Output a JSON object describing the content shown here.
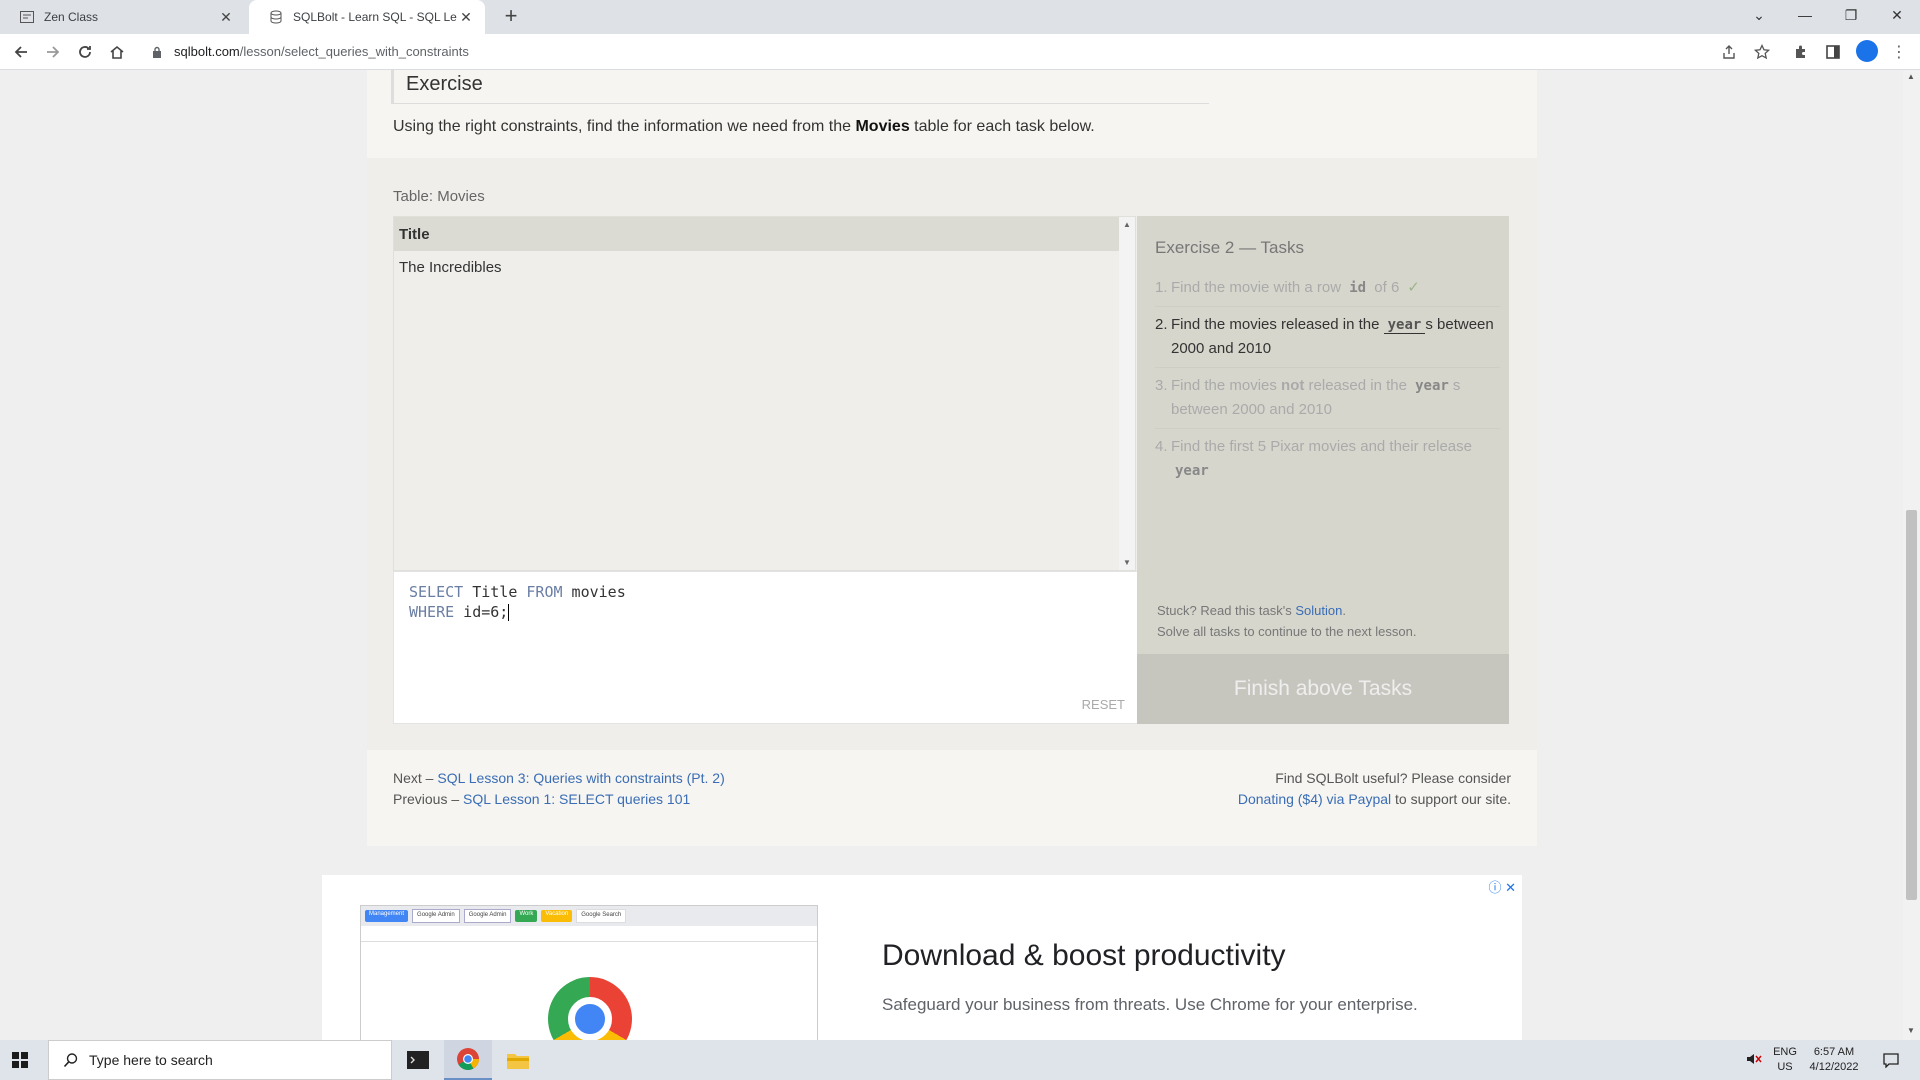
{
  "browser": {
    "tabs": [
      {
        "title": "Zen Class",
        "close": "✕"
      },
      {
        "title": "SQLBolt - Learn SQL - SQL Lesson",
        "close": "✕"
      }
    ],
    "new_tab": "+",
    "url_domain": "sqlbolt.com",
    "url_path": "/lesson/select_queries_with_constraints"
  },
  "page": {
    "exercise_heading": "Exercise",
    "intro_before": "Using the right constraints, find the information we need from the ",
    "intro_bold": "Movies",
    "intro_after": " table for each task below.",
    "table_label": "Table: Movies",
    "results": {
      "columns": [
        "Title"
      ],
      "rows": [
        [
          "The Incredibles"
        ]
      ]
    },
    "editor": {
      "line1": {
        "kw1": "SELECT",
        "t1": " Title ",
        "kw2": "FROM",
        "t2": " movies"
      },
      "line2": {
        "kw1": "WHERE",
        "t1": " id=6;"
      },
      "reset_label": "RESET"
    },
    "tasks": {
      "title": "Exercise 2 — Tasks",
      "items": [
        {
          "num": "1.",
          "pre": "Find the movie with a row ",
          "code": "id",
          "post": " of 6",
          "check": "✓"
        },
        {
          "num": "2.",
          "pre": "Find the movies released in the ",
          "code": "year",
          "post": "s between 2000 and 2010"
        },
        {
          "num": "3.",
          "pre": "Find the movies ",
          "bold": "not",
          "mid": " released in the ",
          "code": "year",
          "post": "s between 2000 and 2010"
        },
        {
          "num": "4.",
          "pre": "Find the first 5 Pixar movies and their release ",
          "code": "year"
        }
      ],
      "stuck_text": "Stuck? Read this task's ",
      "solution_link": "Solution",
      "stuck_end": ".",
      "continue_text": "Solve all tasks to continue to the next lesson.",
      "finish_button": "Finish above Tasks"
    },
    "footer": {
      "next_prefix": "Next – ",
      "next_link": "SQL Lesson 3: Queries with constraints (Pt. 2)",
      "prev_prefix": "Previous – ",
      "prev_link": "SQL Lesson 1: SELECT queries 101",
      "useful_text": "Find SQLBolt useful? Please consider",
      "donate_link": "Donating ($4) via Paypal",
      "donate_suffix": " to support our site."
    }
  },
  "ad": {
    "headline": "Download & boost productivity",
    "subtext": "Safeguard your business from threats. Use Chrome for your enterprise.",
    "chips": [
      "Management",
      "Google Admin",
      "Google Admin",
      "Work",
      "Vacation",
      "Google Search"
    ]
  },
  "taskbar": {
    "search_placeholder": "Type here to search",
    "lang_top": "ENG",
    "lang_bottom": "US",
    "time": "6:57 AM",
    "date": "4/12/2022"
  }
}
